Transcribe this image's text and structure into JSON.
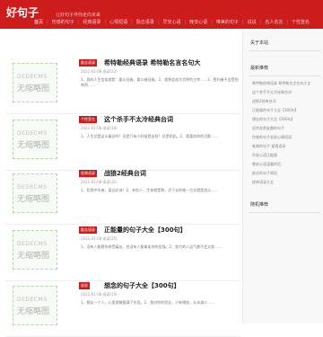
{
  "header": {
    "logo": "好句子",
    "tagline": "让好句子伴你走向未来",
    "nav": [
      "首页",
      "伤感的句子",
      "经典语录",
      "心情短语",
      "励志语录",
      "早安心语",
      "晚安心语",
      "唯美的句子",
      "说说",
      "名人名言",
      "个性签名"
    ]
  },
  "articles": [
    {
      "tag": "励志语录",
      "title": "希特勒经典语录  希特勒名言名句大",
      "meta": "2021-01-08    阅读(22)",
      "excerpt": "1、我的人生信条就是：要么征服，要么被征服。2、我将会成为世界的主宰……3、胜利者不会受到审判……"
    },
    {
      "tag": "个性签名",
      "title": "这个杀手不太冷经典台词",
      "meta": "2021-01-08    阅读(18)",
      "excerpt": "1、人生总是这么痛苦吗？还是只有小时候是这样？总是如此。2、我喜欢你的沉默……"
    },
    {
      "tag": "经典语录",
      "title": "战狼2经典台词",
      "meta": "2021-01-08    阅读(31)",
      "excerpt": "1、犯我中华者，虽远必诛！2、有些人，生来就是狼，活下去的唯一方式就是战斗……"
    },
    {
      "tag": "励志语录",
      "title": "正能量的句子大全【300句】",
      "meta": "2021-01-08    阅读(25)",
      "excerpt": "1、没有人能替你承受痛苦，也没有人能拿走你的坚强。2、努力的人运气都不会太差……"
    },
    {
      "tag": "说说",
      "title": "想念的句子大全【300句】",
      "meta": "2021-01-08    阅读(19)",
      "excerpt": "1、想念一个人，心里就像塞满了东西。2、我对你的思念，只有增加，从未减少……"
    }
  ],
  "thumb": {
    "line1": "DEDECMS",
    "line2": "无缩略图"
  },
  "sidebar": {
    "about_title": "关于本站",
    "recommend_title": "最新推荐",
    "recommend_items": [
      "希特勒经典语录 希特勒名言名句大全",
      "这个杀手不太冷经典台词",
      "战狼2经典台词",
      "正能量的句子大全【300句】",
      "想念的句子大全【300句】",
      "适合发朋友圈的句子",
      "伤感的句子说说心情短语",
      "唯美的句子 爱情语录",
      "早安心语正能量",
      "晚安心语温暖的话",
      "励志的句子简短",
      "经典语录大全"
    ],
    "random_title": "随机推荐"
  }
}
